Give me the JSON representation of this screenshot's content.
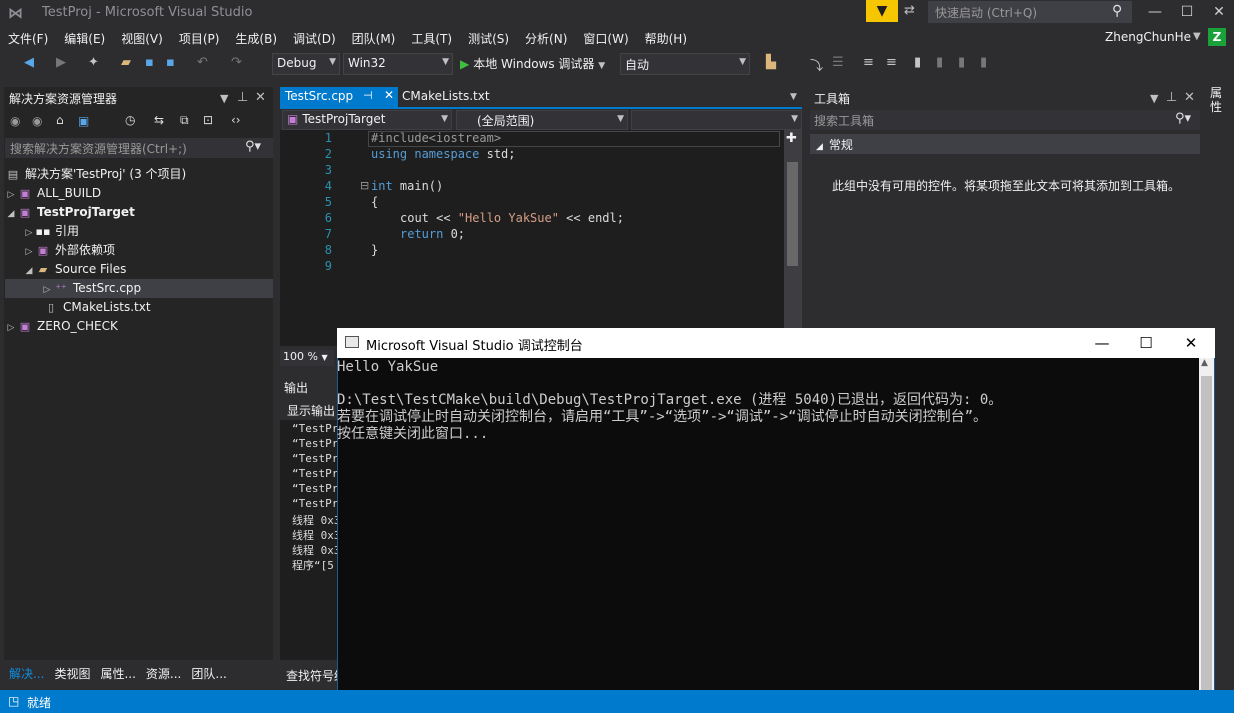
{
  "window": {
    "title": "TestProj - Microsoft Visual Studio",
    "quick_launch_placeholder": "快速启动 (Ctrl+Q)"
  },
  "menu": [
    "文件(F)",
    "编辑(E)",
    "视图(V)",
    "项目(P)",
    "生成(B)",
    "调试(D)",
    "团队(M)",
    "工具(T)",
    "测试(S)",
    "分析(N)",
    "窗口(W)",
    "帮助(H)"
  ],
  "user": {
    "name": "ZhengChunHe",
    "initial": "Z"
  },
  "toolbar": {
    "config": "Debug",
    "platform": "Win32",
    "run_label": "本地 Windows 调试器",
    "run_mode": "自动"
  },
  "solution_explorer": {
    "title": "解决方案资源管理器",
    "search_placeholder": "搜索解决方案资源管理器(Ctrl+;)",
    "items": [
      {
        "label": "解决方案'TestProj' (3 个项目)"
      },
      {
        "label": "ALL_BUILD"
      },
      {
        "label": "TestProjTarget"
      },
      {
        "label": "引用"
      },
      {
        "label": "外部依赖项"
      },
      {
        "label": "Source Files"
      },
      {
        "label": "TestSrc.cpp"
      },
      {
        "label": "CMakeLists.txt"
      },
      {
        "label": "ZERO_CHECK"
      }
    ],
    "bottom_tabs": [
      "解决...",
      "类视图",
      "属性...",
      "资源...",
      "团队..."
    ]
  },
  "editor": {
    "tabs": [
      "TestSrc.cpp",
      "CMakeLists.txt"
    ],
    "project_combo": "TestProjTarget",
    "scope_combo": "(全局范围)",
    "line_numbers": [
      "1",
      "2",
      "3",
      "4",
      "5",
      "6",
      "7",
      "8",
      "9"
    ],
    "zoom": "100 %",
    "code": {
      "l1": "#include<iostream>",
      "l2_kw": "using namespace",
      "l2_rest": " std;",
      "l4_kw": "int",
      "l4_rest": " main()",
      "l5": "{",
      "l6_a": "cout << ",
      "l6_str": "\"Hello YakSue\"",
      "l6_b": " << endl;",
      "l7_kw": "return",
      "l7_rest": " 0;",
      "l8": "}"
    }
  },
  "output": {
    "title": "输出",
    "source_label": "显示输出",
    "lines": [
      "“TestPr",
      "“TestPr",
      "“TestPr",
      "“TestPr",
      "“TestPr",
      "“TestPr",
      "线程 0x3",
      "线程 0x3",
      "线程 0x3",
      "程序“[5"
    ],
    "find_tab": "查找符号结"
  },
  "toolbox": {
    "title": "工具箱",
    "search_placeholder": "搜索工具箱",
    "group": "常规",
    "empty_text": "此组中没有可用的控件。将某项拖至此文本可将其添加到工具箱。",
    "side_label": "属性"
  },
  "console": {
    "title": "Microsoft Visual Studio 调试控制台",
    "lines": [
      "Hello YakSue",
      "",
      "D:\\Test\\TestCMake\\build\\Debug\\TestProjTarget.exe (进程 5040)已退出，返回代码为: 0。",
      "若要在调试停止时自动关闭控制台，请启用“工具”->“选项”->“调试”->“调试停止时自动关闭控制台”。",
      "按任意键关闭此窗口..."
    ]
  },
  "status": {
    "text": "就绪"
  },
  "colors": {
    "accent": "#007acc",
    "background": "#2d2d30",
    "notification": "#f6c700"
  }
}
